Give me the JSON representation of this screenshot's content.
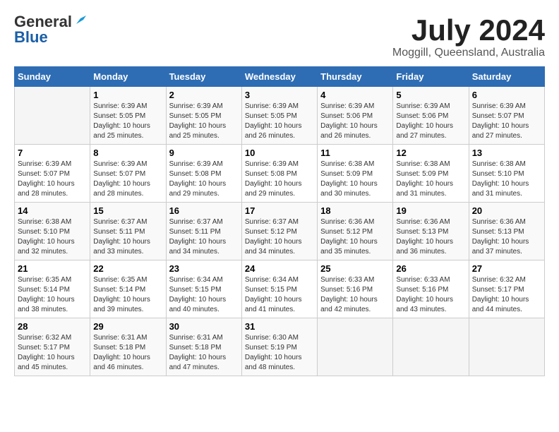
{
  "header": {
    "logo_general": "General",
    "logo_blue": "Blue",
    "month_year": "July 2024",
    "location": "Moggill, Queensland, Australia"
  },
  "days_of_week": [
    "Sunday",
    "Monday",
    "Tuesday",
    "Wednesday",
    "Thursday",
    "Friday",
    "Saturday"
  ],
  "weeks": [
    [
      {
        "day": "",
        "content": ""
      },
      {
        "day": "1",
        "content": "Sunrise: 6:39 AM\nSunset: 5:05 PM\nDaylight: 10 hours\nand 25 minutes."
      },
      {
        "day": "2",
        "content": "Sunrise: 6:39 AM\nSunset: 5:05 PM\nDaylight: 10 hours\nand 25 minutes."
      },
      {
        "day": "3",
        "content": "Sunrise: 6:39 AM\nSunset: 5:05 PM\nDaylight: 10 hours\nand 26 minutes."
      },
      {
        "day": "4",
        "content": "Sunrise: 6:39 AM\nSunset: 5:06 PM\nDaylight: 10 hours\nand 26 minutes."
      },
      {
        "day": "5",
        "content": "Sunrise: 6:39 AM\nSunset: 5:06 PM\nDaylight: 10 hours\nand 27 minutes."
      },
      {
        "day": "6",
        "content": "Sunrise: 6:39 AM\nSunset: 5:07 PM\nDaylight: 10 hours\nand 27 minutes."
      }
    ],
    [
      {
        "day": "7",
        "content": "Sunrise: 6:39 AM\nSunset: 5:07 PM\nDaylight: 10 hours\nand 28 minutes."
      },
      {
        "day": "8",
        "content": "Sunrise: 6:39 AM\nSunset: 5:07 PM\nDaylight: 10 hours\nand 28 minutes."
      },
      {
        "day": "9",
        "content": "Sunrise: 6:39 AM\nSunset: 5:08 PM\nDaylight: 10 hours\nand 29 minutes."
      },
      {
        "day": "10",
        "content": "Sunrise: 6:39 AM\nSunset: 5:08 PM\nDaylight: 10 hours\nand 29 minutes."
      },
      {
        "day": "11",
        "content": "Sunrise: 6:38 AM\nSunset: 5:09 PM\nDaylight: 10 hours\nand 30 minutes."
      },
      {
        "day": "12",
        "content": "Sunrise: 6:38 AM\nSunset: 5:09 PM\nDaylight: 10 hours\nand 31 minutes."
      },
      {
        "day": "13",
        "content": "Sunrise: 6:38 AM\nSunset: 5:10 PM\nDaylight: 10 hours\nand 31 minutes."
      }
    ],
    [
      {
        "day": "14",
        "content": "Sunrise: 6:38 AM\nSunset: 5:10 PM\nDaylight: 10 hours\nand 32 minutes."
      },
      {
        "day": "15",
        "content": "Sunrise: 6:37 AM\nSunset: 5:11 PM\nDaylight: 10 hours\nand 33 minutes."
      },
      {
        "day": "16",
        "content": "Sunrise: 6:37 AM\nSunset: 5:11 PM\nDaylight: 10 hours\nand 34 minutes."
      },
      {
        "day": "17",
        "content": "Sunrise: 6:37 AM\nSunset: 5:12 PM\nDaylight: 10 hours\nand 34 minutes."
      },
      {
        "day": "18",
        "content": "Sunrise: 6:36 AM\nSunset: 5:12 PM\nDaylight: 10 hours\nand 35 minutes."
      },
      {
        "day": "19",
        "content": "Sunrise: 6:36 AM\nSunset: 5:13 PM\nDaylight: 10 hours\nand 36 minutes."
      },
      {
        "day": "20",
        "content": "Sunrise: 6:36 AM\nSunset: 5:13 PM\nDaylight: 10 hours\nand 37 minutes."
      }
    ],
    [
      {
        "day": "21",
        "content": "Sunrise: 6:35 AM\nSunset: 5:14 PM\nDaylight: 10 hours\nand 38 minutes."
      },
      {
        "day": "22",
        "content": "Sunrise: 6:35 AM\nSunset: 5:14 PM\nDaylight: 10 hours\nand 39 minutes."
      },
      {
        "day": "23",
        "content": "Sunrise: 6:34 AM\nSunset: 5:15 PM\nDaylight: 10 hours\nand 40 minutes."
      },
      {
        "day": "24",
        "content": "Sunrise: 6:34 AM\nSunset: 5:15 PM\nDaylight: 10 hours\nand 41 minutes."
      },
      {
        "day": "25",
        "content": "Sunrise: 6:33 AM\nSunset: 5:16 PM\nDaylight: 10 hours\nand 42 minutes."
      },
      {
        "day": "26",
        "content": "Sunrise: 6:33 AM\nSunset: 5:16 PM\nDaylight: 10 hours\nand 43 minutes."
      },
      {
        "day": "27",
        "content": "Sunrise: 6:32 AM\nSunset: 5:17 PM\nDaylight: 10 hours\nand 44 minutes."
      }
    ],
    [
      {
        "day": "28",
        "content": "Sunrise: 6:32 AM\nSunset: 5:17 PM\nDaylight: 10 hours\nand 45 minutes."
      },
      {
        "day": "29",
        "content": "Sunrise: 6:31 AM\nSunset: 5:18 PM\nDaylight: 10 hours\nand 46 minutes."
      },
      {
        "day": "30",
        "content": "Sunrise: 6:31 AM\nSunset: 5:18 PM\nDaylight: 10 hours\nand 47 minutes."
      },
      {
        "day": "31",
        "content": "Sunrise: 6:30 AM\nSunset: 5:19 PM\nDaylight: 10 hours\nand 48 minutes."
      },
      {
        "day": "",
        "content": ""
      },
      {
        "day": "",
        "content": ""
      },
      {
        "day": "",
        "content": ""
      }
    ]
  ]
}
